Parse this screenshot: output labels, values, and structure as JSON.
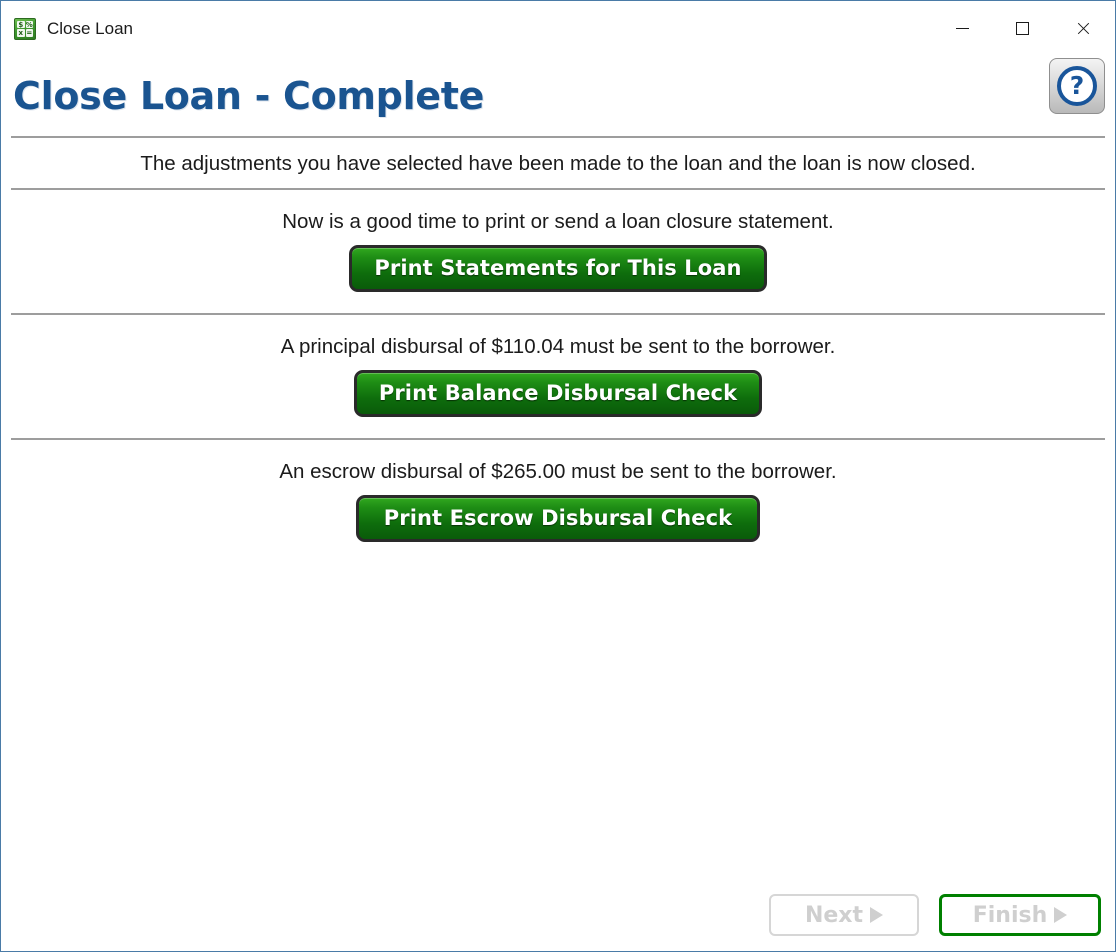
{
  "window": {
    "title": "Close Loan",
    "icon": "calculator-icon",
    "icon_glyphs": [
      "$",
      "%",
      "x",
      "="
    ],
    "border_color": "#4a7ba7",
    "controls": {
      "minimize": "minimize-icon",
      "maximize": "maximize-icon",
      "close": "close-icon"
    }
  },
  "header": {
    "page_title": "Close Loan - Complete",
    "title_color": "#1a5490",
    "help": {
      "icon": "help-question-icon",
      "glyph": "?",
      "color": "#19559a"
    }
  },
  "content": {
    "intro": "The adjustments you have selected have been made to the loan and the loan is now closed.",
    "sections": [
      {
        "text": "Now is a good time to print or send a loan closure statement.",
        "button_label": "Print Statements for This Loan",
        "button_name": "print-statements-button"
      },
      {
        "text": "A principal disbursal of $110.04 must be sent to the borrower.",
        "button_label": "Print Balance Disbursal Check",
        "button_name": "print-balance-disbursal-check-button",
        "amount": "$110.04"
      },
      {
        "text": "An escrow disbursal of $265.00 must be sent to the borrower.",
        "button_label": "Print Escrow Disbursal Check",
        "button_name": "print-escrow-disbursal-check-button",
        "amount": "$265.00"
      }
    ],
    "button_accent": "#1f8e15"
  },
  "footer": {
    "next_label": "Next",
    "finish_label": "Finish",
    "next_enabled": false,
    "finish_enabled": false,
    "finish_border_color": "#008000",
    "disabled_text_color": "#cfcfcf"
  }
}
